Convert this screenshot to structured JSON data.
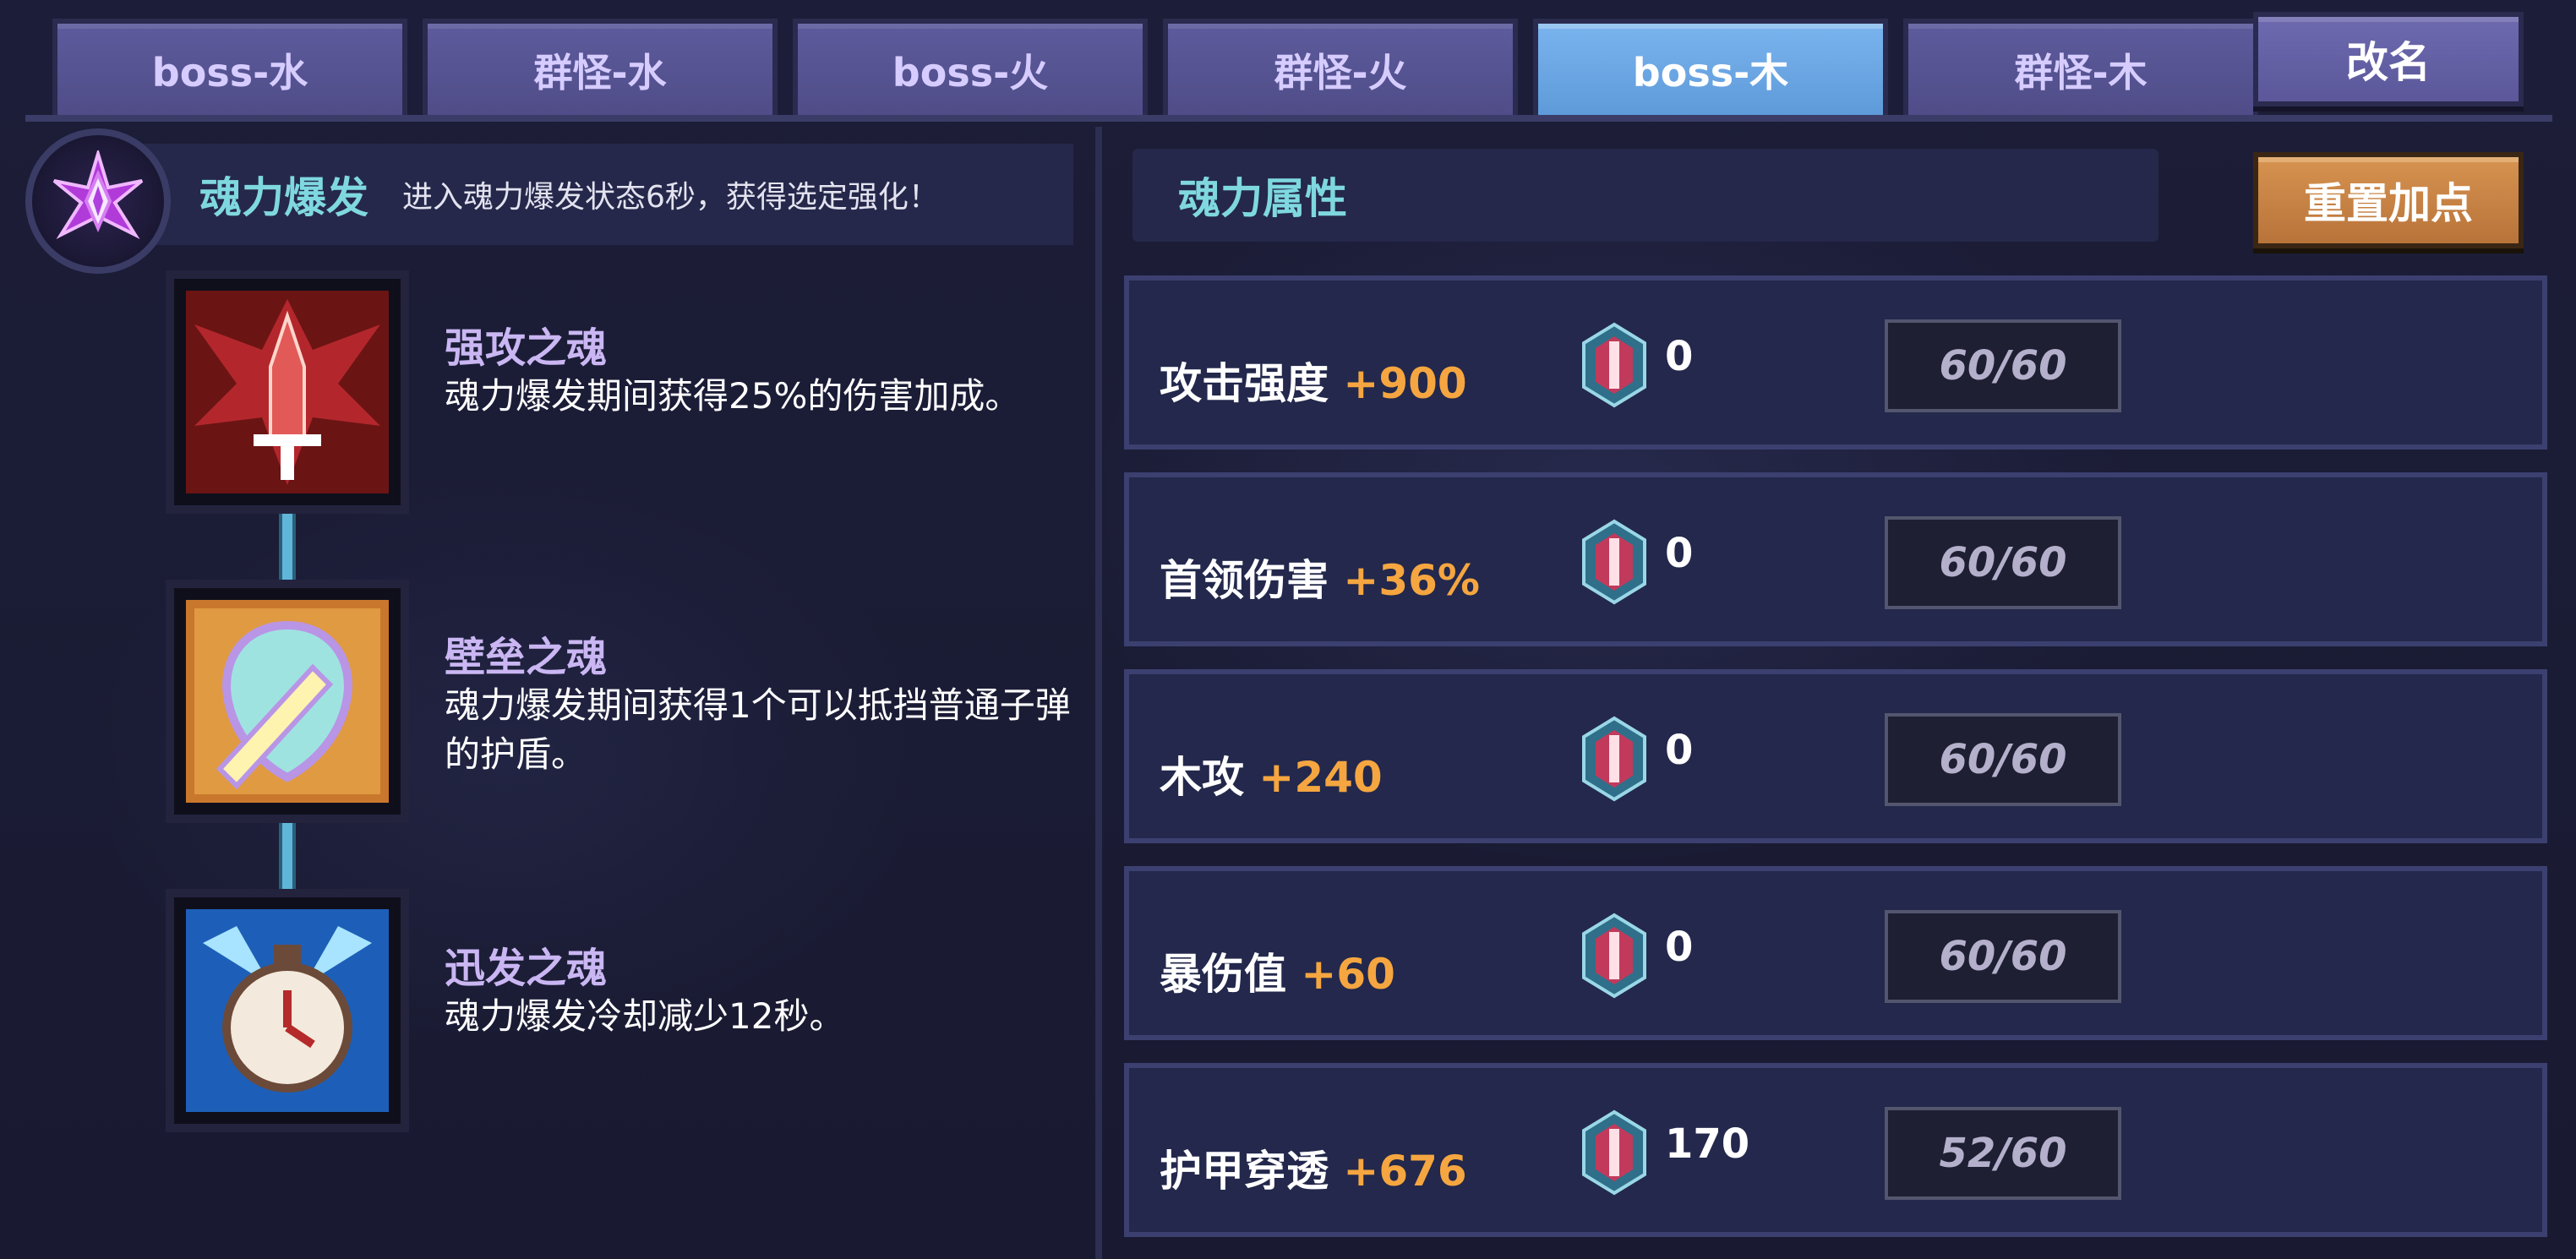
{
  "tabs": [
    {
      "label": "boss-水",
      "active": false
    },
    {
      "label": "群怪-水",
      "active": false
    },
    {
      "label": "boss-火",
      "active": false
    },
    {
      "label": "群怪-火",
      "active": false
    },
    {
      "label": "boss-木",
      "active": true
    },
    {
      "label": "群怪-木",
      "active": false
    }
  ],
  "rename_label": "改名",
  "burst": {
    "title": "魂力爆发",
    "description": "进入魂力爆发状态6秒，获得选定强化！",
    "icon": "crystal-star-icon"
  },
  "skills": [
    {
      "name": "强攻之魂",
      "description": "魂力爆发期间获得25%的伤害加成。",
      "icon": "red-sword-spirit-icon"
    },
    {
      "name": "壁垒之魂",
      "description": "魂力爆发期间获得1个可以抵挡普通子弹的护盾。",
      "icon": "shield-spirit-icon"
    },
    {
      "name": "迅发之魂",
      "description": "魂力爆发冷却减少12秒。",
      "icon": "clock-spirit-icon"
    }
  ],
  "attributes_title": "魂力属性",
  "reset_label": "重置加点",
  "attributes": [
    {
      "name": "攻击强度",
      "bonus": "+900",
      "gems": "0",
      "level": "60/60"
    },
    {
      "name": "首领伤害",
      "bonus": "+36%",
      "gems": "0",
      "level": "60/60"
    },
    {
      "name": "木攻",
      "bonus": "+240",
      "gems": "0",
      "level": "60/60"
    },
    {
      "name": "暴伤值",
      "bonus": "+60",
      "gems": "0",
      "level": "60/60"
    },
    {
      "name": "护甲穿透",
      "bonus": "+676",
      "gems": "170",
      "level": "52/60"
    }
  ],
  "colors": {
    "accent_teal": "#7fd8df",
    "bonus_orange": "#f5a640",
    "active_tab": "#6ea7e4",
    "tab": "#57548f",
    "reset_button": "#c8843f"
  }
}
